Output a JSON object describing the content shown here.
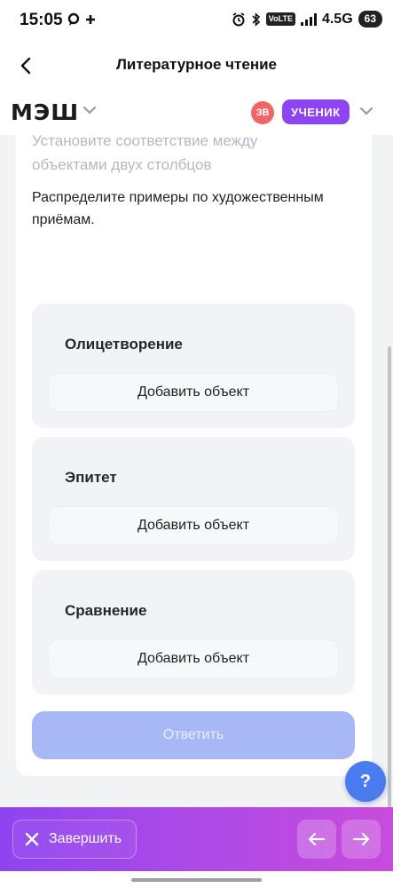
{
  "status_bar": {
    "time": "15:05",
    "volte": "VoLTE",
    "network": "4.5G",
    "battery": "63"
  },
  "header": {
    "title": "Литературное чтение"
  },
  "brand": {
    "logo_text": "МЭШ",
    "avatar_initials": "ЗВ",
    "role_label": "УЧЕНИК"
  },
  "task": {
    "instruction": "Установите соответствие между объектами двух столбцов",
    "text": "Распределите примеры по художественным приёмам.",
    "categories": [
      {
        "title": "Олицетворение",
        "add_label": "Добавить объект"
      },
      {
        "title": "Эпитет",
        "add_label": "Добавить объект"
      },
      {
        "title": "Сравнение",
        "add_label": "Добавить объект"
      }
    ],
    "answer_label": "Ответить"
  },
  "help": {
    "label": "?"
  },
  "bottom_bar": {
    "finish_label": "Завершить"
  },
  "colors": {
    "accent_purple": "#8e44f0",
    "answer_disabled": "#a8b8f6",
    "help_blue": "#4a7cf0",
    "avatar_red": "#f06667"
  },
  "icons": {
    "back": "chevron-left-icon",
    "brand_menu": "chevron-down-icon",
    "close": "close-icon",
    "prev": "arrow-left-icon",
    "next": "arrow-right-icon"
  }
}
